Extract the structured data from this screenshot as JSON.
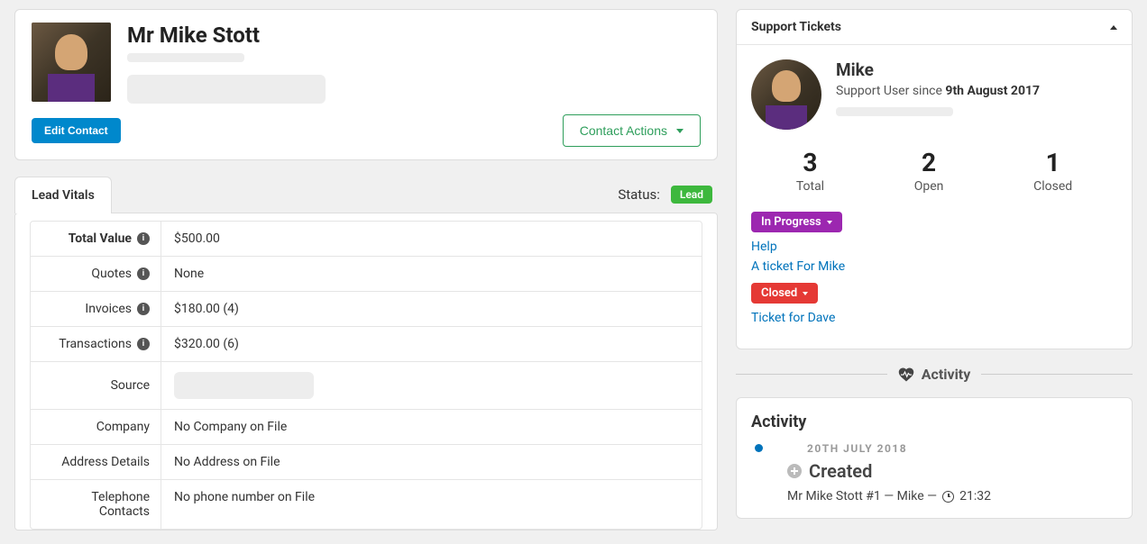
{
  "contact": {
    "name": "Mr Mike Stott",
    "edit_button": "Edit Contact",
    "actions_button": "Contact Actions"
  },
  "tabs": {
    "lead_vitals": "Lead Vitals",
    "status_label": "Status:",
    "status_badge": "Lead"
  },
  "vitals": {
    "rows": [
      {
        "label": "Total Value",
        "value": "$500.00",
        "bold": true,
        "info": true
      },
      {
        "label": "Quotes",
        "value": "None",
        "info": true
      },
      {
        "label": "Invoices",
        "value": "$180.00 (4)",
        "info": true
      },
      {
        "label": "Transactions",
        "value": "$320.00 (6)",
        "info": true
      },
      {
        "label": "Source",
        "value": "",
        "skeleton": true
      },
      {
        "label": "Company",
        "value": "No Company on File"
      },
      {
        "label": "Address Details",
        "value": "No Address on File"
      },
      {
        "label": "Telephone Contacts",
        "value": "No phone number on File"
      }
    ]
  },
  "support": {
    "panel_title": "Support Tickets",
    "name": "Mike",
    "since_prefix": "Support User since ",
    "since_date": "9th August 2017",
    "stats": {
      "total": {
        "value": "3",
        "label": "Total"
      },
      "open": {
        "value": "2",
        "label": "Open"
      },
      "closed": {
        "value": "1",
        "label": "Closed"
      }
    },
    "groups": [
      {
        "badge": "In Progress",
        "badge_color": "purple",
        "links": [
          "Help",
          "A ticket For Mike"
        ]
      },
      {
        "badge": "Closed",
        "badge_color": "red",
        "links": [
          "Ticket for Dave"
        ]
      }
    ]
  },
  "activity_section_label": "Activity",
  "activity": {
    "title": "Activity",
    "date": "20TH JULY 2018",
    "event": "Created",
    "meta_subject": "Mr Mike Stott #1 — Mike —",
    "meta_time": "21:32"
  }
}
